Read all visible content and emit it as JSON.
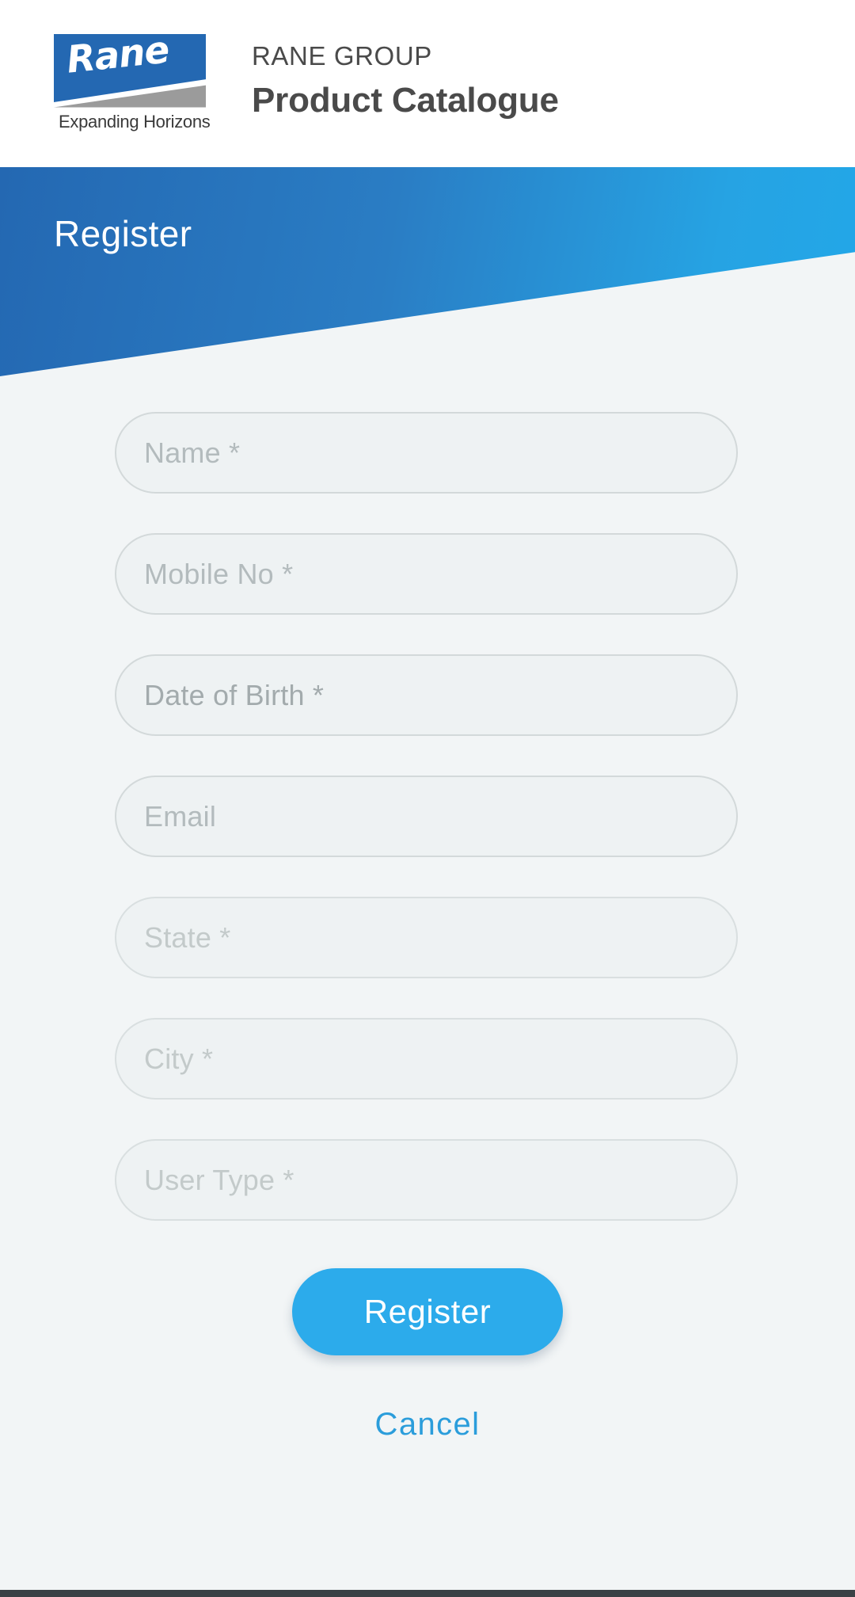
{
  "header": {
    "logo": {
      "wordmark": "Rane",
      "tagline": "Expanding Horizons"
    },
    "eyebrow": "RANE GROUP",
    "title": "Product Catalogue"
  },
  "hero": {
    "title": "Register"
  },
  "form": {
    "fields": [
      {
        "name": "name",
        "placeholder": "Name *",
        "tone": ""
      },
      {
        "name": "mobile-no",
        "placeholder": "Mobile No *",
        "tone": ""
      },
      {
        "name": "date-of-birth",
        "placeholder": "Date of Birth *",
        "tone": "tone-dark"
      },
      {
        "name": "email",
        "placeholder": "Email",
        "tone": ""
      },
      {
        "name": "state",
        "placeholder": "State *",
        "tone": "tone-faint"
      },
      {
        "name": "city",
        "placeholder": "City *",
        "tone": "tone-faint"
      },
      {
        "name": "user-type",
        "placeholder": "User Type *",
        "tone": "tone-faint"
      }
    ],
    "submit_label": "Register",
    "cancel_label": "Cancel"
  },
  "colors": {
    "brand_blue": "#2468b2",
    "accent_blue": "#2cabeb",
    "link_blue": "#2b9ddb",
    "page_background": "#f2f5f6",
    "field_background": "#eef2f3",
    "field_border": "#d3d9da",
    "logo_gray": "#9b9b9b",
    "navbar": "#3a4145"
  }
}
